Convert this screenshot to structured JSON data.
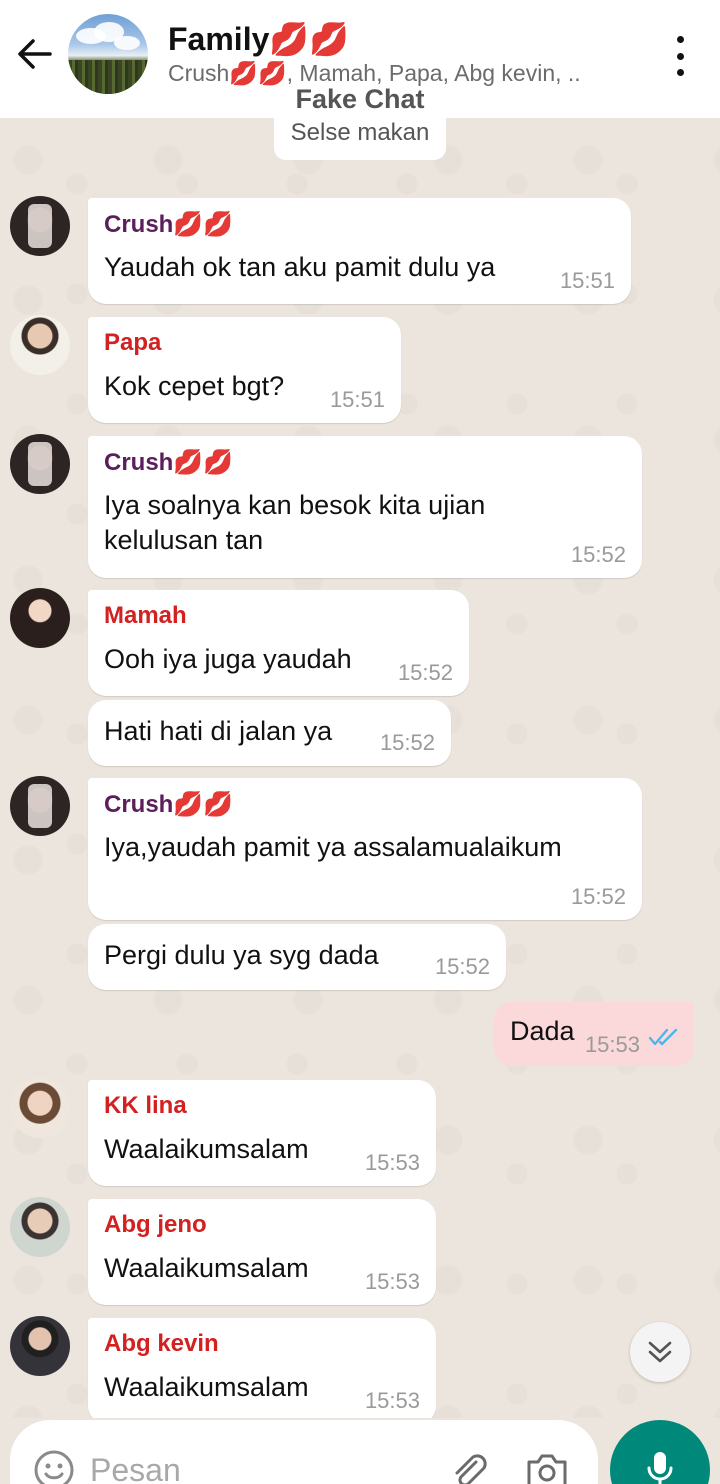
{
  "header": {
    "title": "Family💋💋",
    "subtitle": "Crush💋💋, Mamah, Papa, Abg kevin, ..",
    "back_icon": "arrow-back-icon",
    "menu_icon": "more-vertical-icon"
  },
  "system": {
    "label": "Fake Chat",
    "message": "Selse makan"
  },
  "messages": [
    {
      "sender": "Crush💋💋",
      "text": "Yaudah ok tan aku pamit dulu ya",
      "time": "15:51"
    },
    {
      "sender": "Papa",
      "text": "Kok cepet bgt?",
      "time": "15:51"
    },
    {
      "sender": "Crush💋💋",
      "text_line1": "Iya soalnya kan besok kita ujian",
      "text_line2": "kelulusan tan",
      "time": "15:52"
    },
    {
      "sender": "Mamah",
      "text": "Ooh iya juga yaudah",
      "time": "15:52"
    },
    {
      "text": "Hati hati di jalan ya",
      "time": "15:52"
    },
    {
      "sender": "Crush💋💋",
      "text": "Iya,yaudah pamit ya assalamualaikum",
      "time": "15:52"
    },
    {
      "text": "Pergi dulu ya syg dada",
      "time": "15:52"
    },
    {
      "text": "Dada",
      "time": "15:53",
      "outgoing": true
    },
    {
      "sender": "KK lina",
      "text": "Waalaikumsalam",
      "time": "15:53"
    },
    {
      "sender": "Abg jeno",
      "text": "Waalaikumsalam",
      "time": "15:53"
    },
    {
      "sender": "Abg kevin",
      "text": "Waalaikumsalam",
      "time": "15:53"
    }
  ],
  "input": {
    "placeholder": "Pesan",
    "emoji_icon": "emoji-icon",
    "attach_icon": "paperclip-icon",
    "camera_icon": "camera-icon",
    "mic_icon": "mic-icon"
  },
  "colors": {
    "crush_name": "#5b1e5b",
    "other_name": "#d32020",
    "outgoing_bubble": "#fbd9da",
    "mic_button": "#00897b",
    "read_ticks": "#4fb6ec"
  }
}
